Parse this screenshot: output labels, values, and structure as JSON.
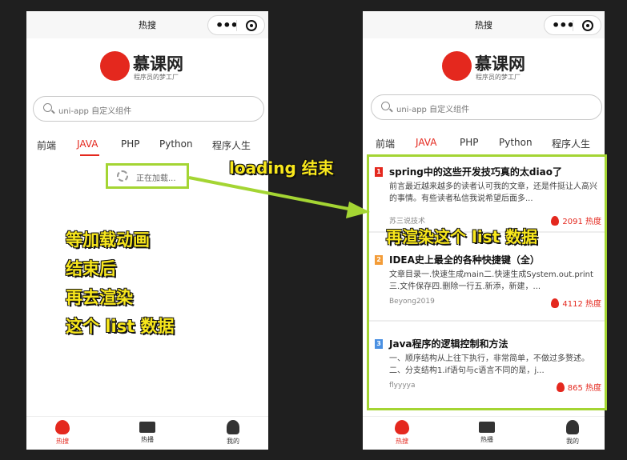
{
  "page": {
    "title": "热搜"
  },
  "colors": {
    "accent": "#e4281e",
    "highlight": "#a4d533",
    "overlay_text": "#f8e71c"
  },
  "logo": {
    "name": "慕课网",
    "subtitle": "程序员的梦工厂"
  },
  "search": {
    "placeholder": "uni-app 自定义组件"
  },
  "tabs": [
    "前端",
    "JAVA",
    "PHP",
    "Python",
    "程序人生"
  ],
  "active_tab": "JAVA",
  "loading_text": "正在加载...",
  "annotations": {
    "loading_end": "loading 结束",
    "left_1": "等加载动画",
    "left_2": "结束后",
    "left_3": "再去渲染",
    "left_4": "这个 list 数据",
    "right": "再渲染这个 list 数据"
  },
  "articles": [
    {
      "rank": "1",
      "rank_color": "#e4281e",
      "title": "spring中的这些开发技巧真的太diao了",
      "desc": "前言最近越来越多的读者认可我的文章，还是件挺让人高兴的事情。有些读者私信我说希望后面多...",
      "author": "苏三说技术",
      "hot": "2091 热度"
    },
    {
      "rank": "2",
      "rank_color": "#f39c38",
      "title": "IDEA史上最全的各种快捷键（全）",
      "desc": "文章目录一.快速生成main二.快速生成System.out.print三.文件保存四.删除一行五.新添，新建，...",
      "author": "Beyong2019",
      "hot": "4112 热度"
    },
    {
      "rank": "3",
      "rank_color": "#4a90e2",
      "title": "Java程序的逻辑控制和方法",
      "desc": "一、顺序结构从上往下执行，非常简单，不做过多赘述。二、分支结构1.if语句与c语言不同的是，j...",
      "author": "flyyyya",
      "hot": "865 热度"
    }
  ],
  "bottom_nav": [
    {
      "label": "热搜",
      "icon": "flame-icon"
    },
    {
      "label": "热播",
      "icon": "video-icon"
    },
    {
      "label": "我的",
      "icon": "user-icon"
    }
  ]
}
